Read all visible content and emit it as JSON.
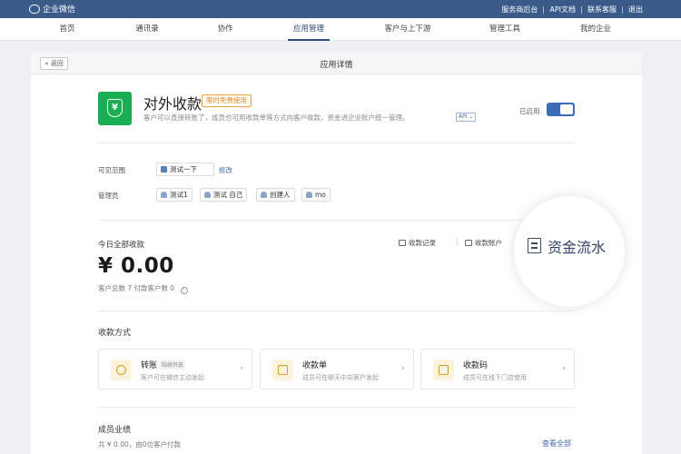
{
  "topbar": {
    "logo_text": "企业微信",
    "links": [
      "服务商后台",
      "API文档",
      "联系客服",
      "退出"
    ]
  },
  "nav": {
    "tabs": [
      "首页",
      "通讯录",
      "协作",
      "应用管理",
      "客户与上下游",
      "管理工具",
      "我的企业"
    ],
    "active": "应用管理"
  },
  "panel": {
    "back_label": "« 返回",
    "title": "应用详情"
  },
  "app": {
    "icon_glyph": "¥",
    "name": "对外收款",
    "badge": "限时免费使用",
    "description": "客户可以直接转账了，成员也可用收款单等方式向客户收款，资金进企业账户统一管理。",
    "api_tag": "API ⌄",
    "enabled_label": "已启用",
    "enabled": true,
    "brand_color": "#1aad52"
  },
  "visibility": {
    "label": "可见范围",
    "value": "测试一下",
    "edit_label": "修改"
  },
  "admins": {
    "label": "管理员",
    "items": [
      "测试1",
      "测试 自己",
      "创建人",
      "mo"
    ]
  },
  "today": {
    "title": "今日全部收款",
    "amount": "¥ 0.00",
    "stats": "客户总数 7   付款客户数 0",
    "records_link": "收款记录",
    "account_link": "收款账户",
    "spotlight_label": "资金流水"
  },
  "methods": {
    "title": "收款方式",
    "items": [
      {
        "title": "转账",
        "badge": "陆续开放",
        "desc": "客户可在微信主动发起",
        "icon": "transfer-icon"
      },
      {
        "title": "收款单",
        "badge": "",
        "desc": "成员可在聊天中向客户发起",
        "icon": "invoice-icon"
      },
      {
        "title": "收款码",
        "badge": "",
        "desc": "成员可在线下门店使用",
        "icon": "qr-code-icon"
      }
    ]
  },
  "performance": {
    "title": "成员业绩",
    "summary": "共 ¥ 0.00，由0位客户付款",
    "see_all": "查看全部"
  }
}
